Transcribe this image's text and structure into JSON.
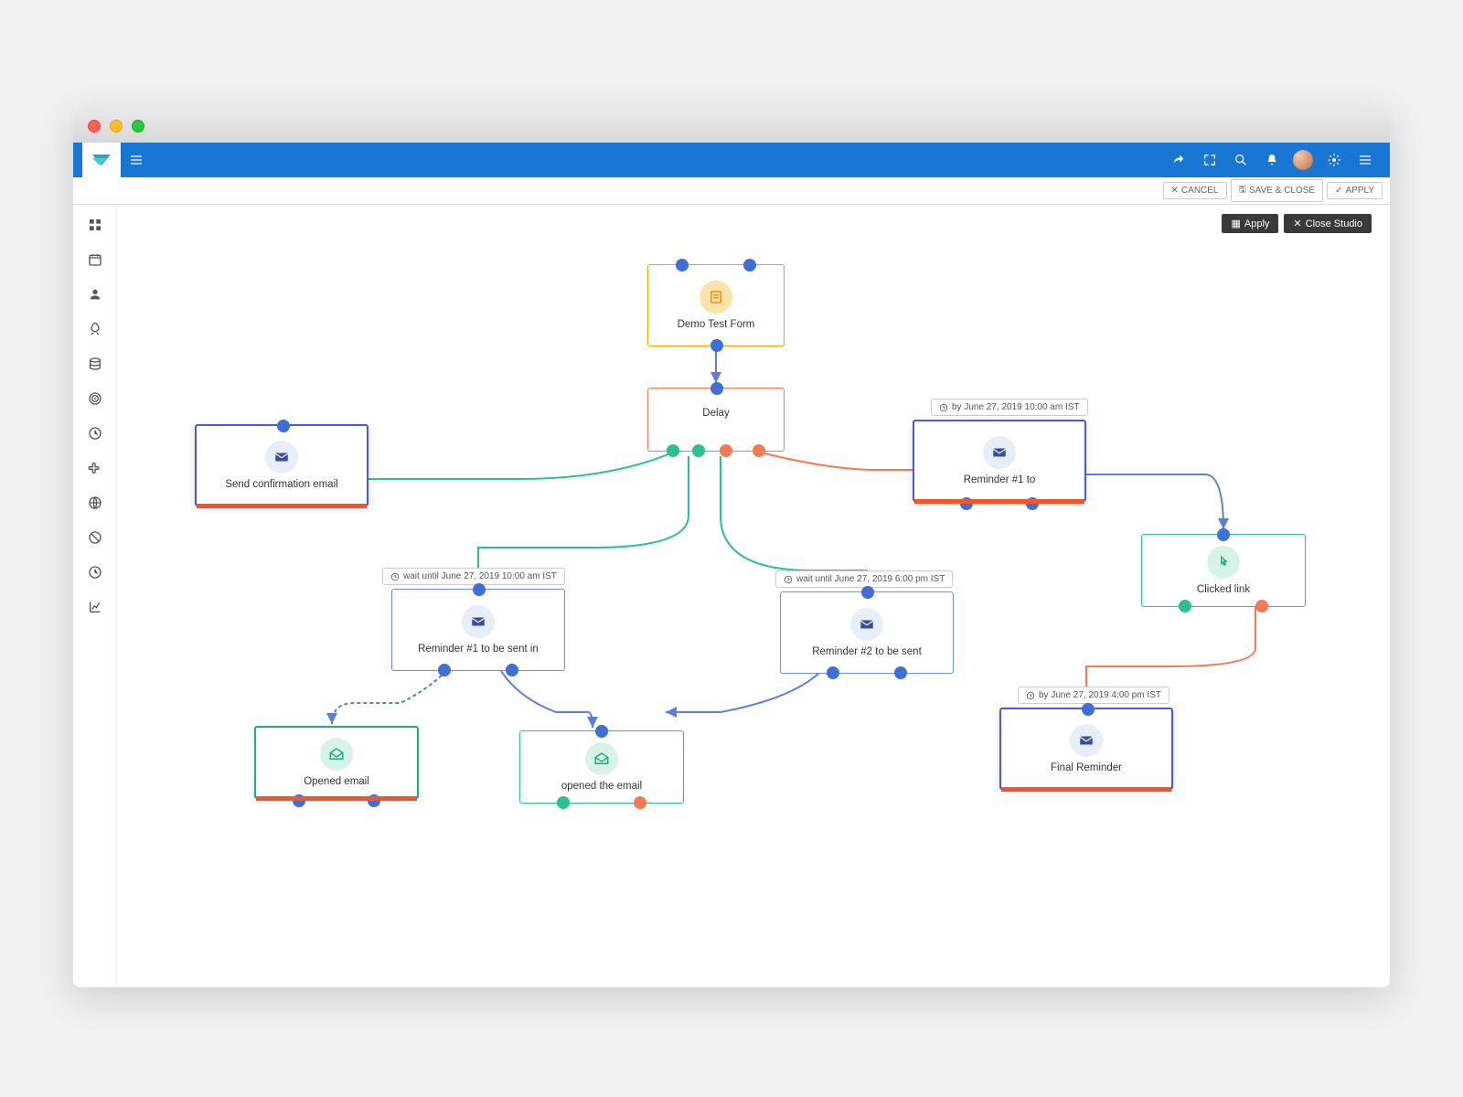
{
  "window": {
    "actions": {
      "cancel": "CANCEL",
      "save_close": "SAVE & CLOSE",
      "apply": "APPLY"
    }
  },
  "studio": {
    "apply": "Apply",
    "close": "Close Studio"
  },
  "nodes": {
    "start": {
      "label": "Demo Test Form"
    },
    "delay": {
      "label": "Delay"
    },
    "send_confirm": {
      "label": "Send confirmation email"
    },
    "reminder1_to": {
      "label": "Reminder #1 to",
      "schedule": "by June 27, 2019 10:00 am IST"
    },
    "reminder1_sent": {
      "label": "Reminder #1 to be sent in",
      "schedule": "wait until June 27, 2019 10:00 am IST"
    },
    "reminder2_sent": {
      "label": "Reminder #2 to be sent",
      "schedule": "wait until June 27, 2019 6:00 pm IST"
    },
    "opened_email": {
      "label": "Opened email"
    },
    "opened_the_email": {
      "label": "opened the email"
    },
    "clicked_link": {
      "label": "Clicked link"
    },
    "final_reminder": {
      "label": "Final Reminder",
      "schedule": "by June 27, 2019 4:00 pm IST"
    }
  }
}
